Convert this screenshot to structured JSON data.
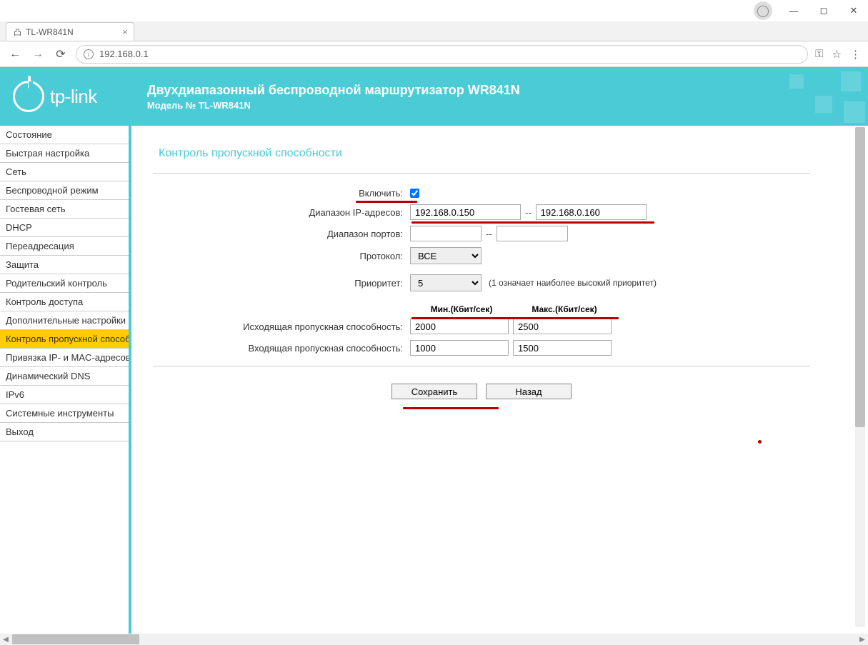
{
  "browser": {
    "tab_title": "TL-WR841N",
    "url": "192.168.0.1"
  },
  "header": {
    "brand": "tp-link",
    "title": "Двухдиапазонный беспроводной маршрутизатор WR841N",
    "model": "Модель № TL-WR841N"
  },
  "sidebar": {
    "items": [
      "Состояние",
      "Быстрая настройка",
      "Сеть",
      "Беспроводной режим",
      "Гостевая сеть",
      "DHCP",
      "Переадресация",
      "Защита",
      "Родительский контроль",
      "Контроль доступа",
      "Дополнительные настройки маршрутизации",
      "Контроль пропускной способности",
      "Привязка IP- и MAC-адресов",
      "Динамический DNS",
      "IPv6",
      "Системные инструменты",
      "Выход"
    ],
    "active_index": 11
  },
  "page": {
    "title": "Контроль пропускной способности",
    "labels": {
      "enable": "Включить:",
      "ip_range": "Диапазон IP-адресов:",
      "port_range": "Диапазон портов:",
      "protocol": "Протокол:",
      "priority": "Приоритет:",
      "egress": "Исходящая пропускная способность:",
      "ingress": "Входящая пропускная способность:"
    },
    "values": {
      "enable": true,
      "ip_from": "192.168.0.150",
      "ip_to": "192.168.0.160",
      "port_from": "",
      "port_to": "",
      "protocol": "ВСЕ",
      "priority": "5",
      "egress_min": "2000",
      "egress_max": "2500",
      "ingress_min": "1000",
      "ingress_max": "1500"
    },
    "hints": {
      "priority": "(1 означает наиболее высокий приоритет)"
    },
    "th": {
      "min": "Мин.(Кбит/сек)",
      "max": "Макс.(Кбит/сек)"
    },
    "buttons": {
      "save": "Сохранить",
      "back": "Назад"
    }
  }
}
